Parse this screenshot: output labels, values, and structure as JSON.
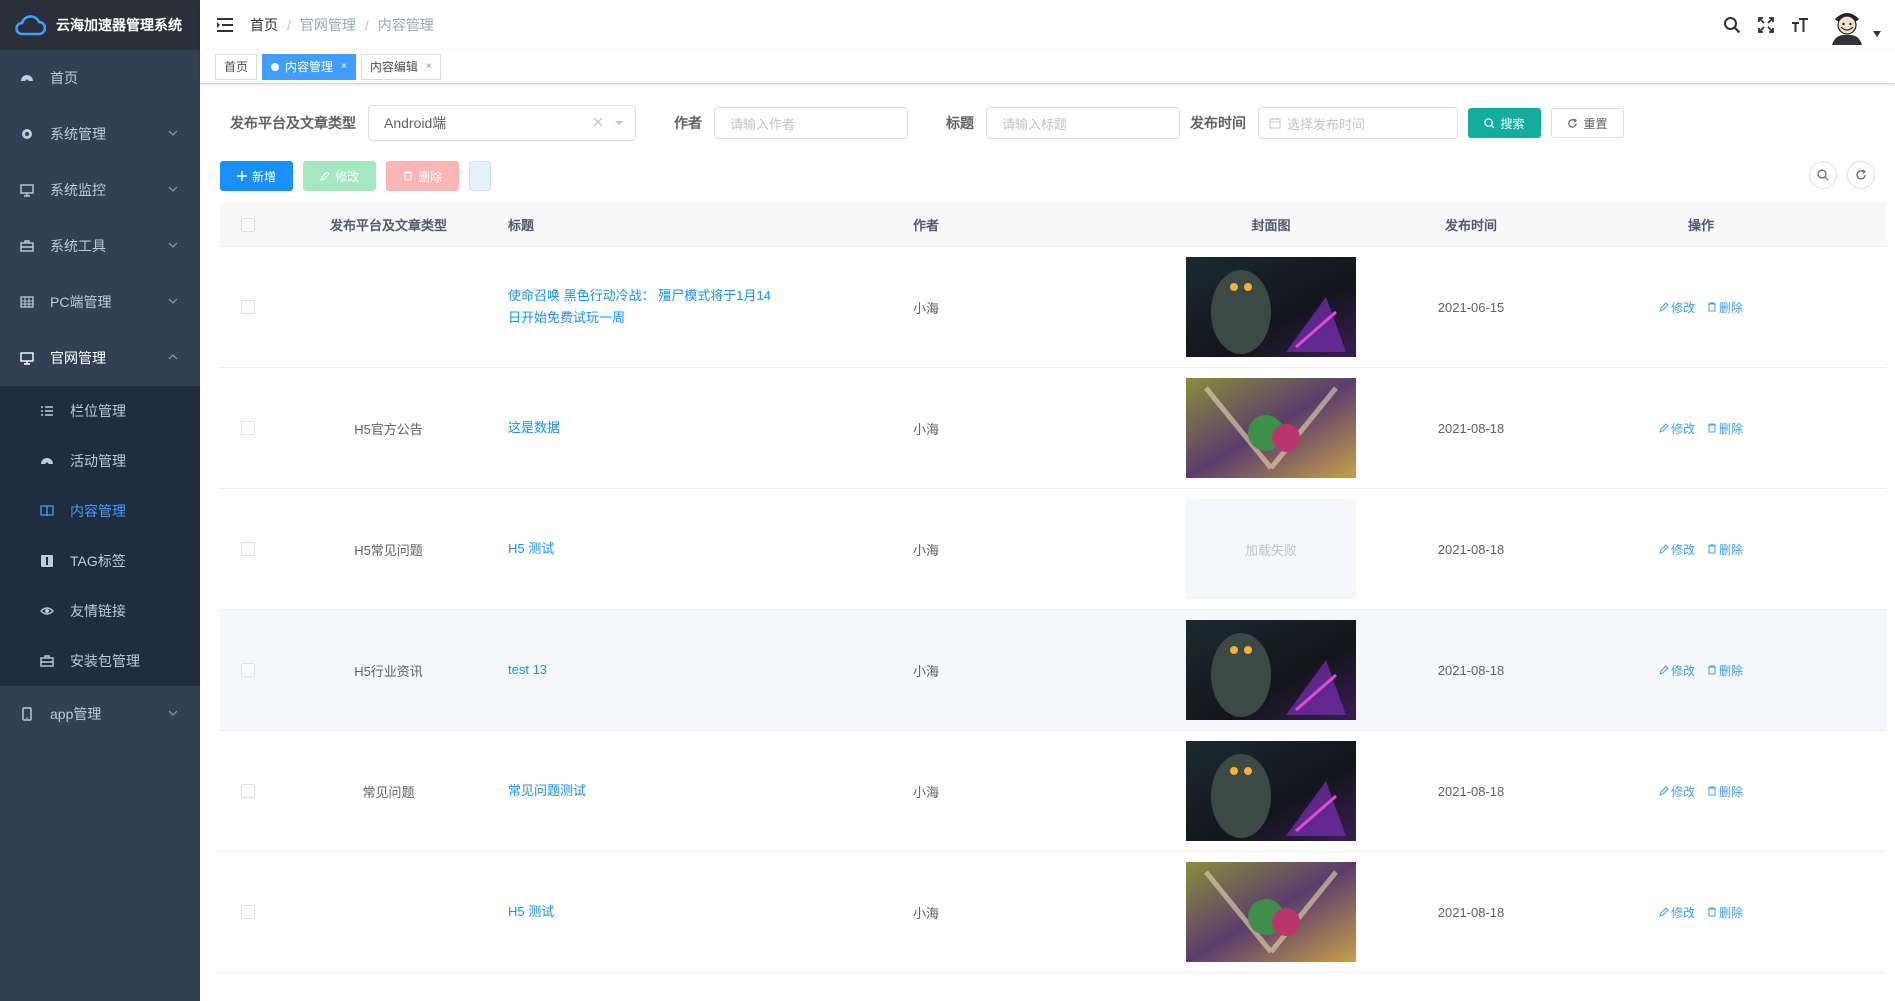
{
  "app": {
    "title": "云海加速器管理系统"
  },
  "sidebar": {
    "items": [
      {
        "label": "首页"
      },
      {
        "label": "系统管理"
      },
      {
        "label": "系统监控"
      },
      {
        "label": "系统工具"
      },
      {
        "label": "PC端管理"
      },
      {
        "label": "官网管理"
      }
    ],
    "sub_items": [
      {
        "label": "栏位管理"
      },
      {
        "label": "活动管理"
      },
      {
        "label": "内容管理"
      },
      {
        "label": "TAG标签"
      },
      {
        "label": "友情链接"
      },
      {
        "label": "安装包管理"
      }
    ],
    "last_item": {
      "label": "app管理"
    }
  },
  "breadcrumb": {
    "b1": "首页",
    "b2": "官网管理",
    "b3": "内容管理"
  },
  "tags": {
    "t1": "首页",
    "t2": "内容管理",
    "t3": "内容编辑"
  },
  "search": {
    "platform_label": "发布平台及文章类型",
    "platform_value": "Android端",
    "author_label": "作者",
    "author_placeholder": "请输入作者",
    "title_label": "标题",
    "title_placeholder": "请输入标题",
    "date_label": "发布时间",
    "date_placeholder": "选择发布时间",
    "search_btn": "搜索",
    "reset_btn": "重置"
  },
  "toolbar": {
    "add": "新增",
    "edit": "修改",
    "delete": "删除"
  },
  "table": {
    "headers": {
      "platform": "发布平台及文章类型",
      "title": "标题",
      "author": "作者",
      "cover": "封面图",
      "date": "发布时间",
      "ops": "操作"
    },
    "op_edit": "修改",
    "op_delete": "删除",
    "cover_failed": "加载失败",
    "rows": [
      {
        "platform": "",
        "title": "使命召唤 黑色行动冷战： 殭尸模式将于1月14日开始免费试玩一周",
        "author": "小海",
        "date": "2021-06-15",
        "cover": "codcw"
      },
      {
        "platform": "H5官方公告",
        "title": "这是数据",
        "author": "小海",
        "date": "2021-08-18",
        "cover": "legends"
      },
      {
        "platform": "H5常见问题",
        "title": "H5 测试",
        "author": "小海",
        "date": "2021-08-18",
        "cover": "failed"
      },
      {
        "platform": "H5行业资讯",
        "title": "test 13",
        "author": "小海",
        "date": "2021-08-18",
        "cover": "codcw"
      },
      {
        "platform": "常见问题",
        "title": "常见问题测试",
        "author": "小海",
        "date": "2021-08-18",
        "cover": "codcw"
      },
      {
        "platform": "",
        "title": "H5 测试",
        "author": "小海",
        "date": "2021-08-18",
        "cover": "legends"
      }
    ]
  },
  "colors": {
    "sidebar": "#304156",
    "active": "#409eff",
    "primary": "#1890ff",
    "search": "#13ad9e"
  }
}
